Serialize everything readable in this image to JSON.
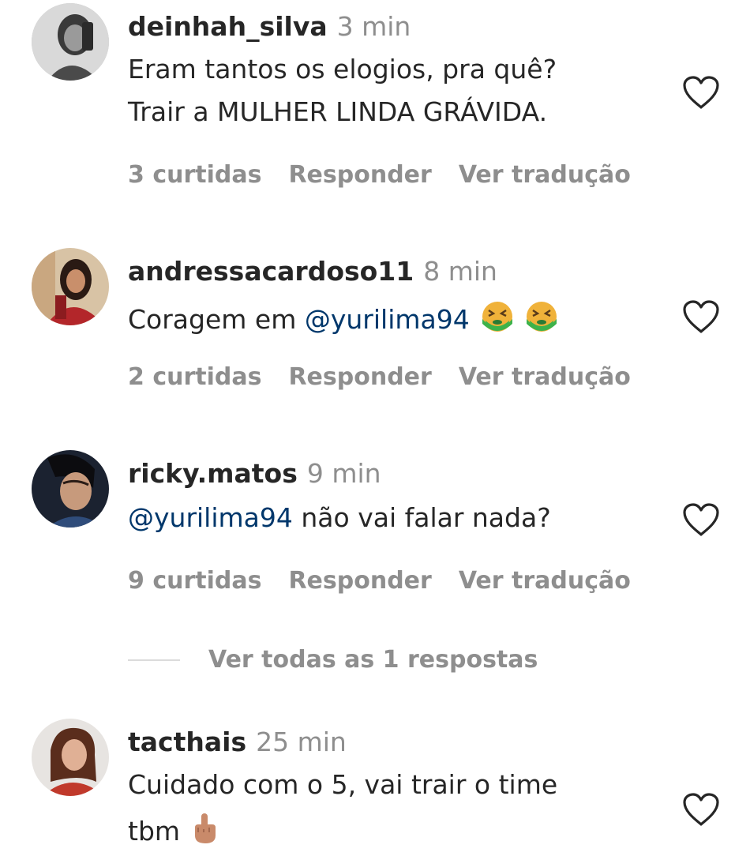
{
  "colors": {
    "text": "#262626",
    "secondary": "#8e8e8e",
    "mention": "#00376b",
    "divider": "#dbdbdb"
  },
  "comments": [
    {
      "username": "deinhah_silva",
      "time": "3 min",
      "lines": [
        "Eram tantos os elogios, pra quê?",
        "Trair a MULHER LINDA GRÁVIDA."
      ],
      "likes": "3 curtidas",
      "reply": "Responder",
      "translate": "Ver tradução",
      "heart_icon": "heart-outline-icon"
    },
    {
      "username": "andressacardoso11",
      "time": "8 min",
      "text_before": "Coragem em ",
      "mention": "@yurilima94",
      "emojis": [
        "nauseated-face-emoji",
        "nauseated-face-emoji"
      ],
      "likes": "2 curtidas",
      "reply": "Responder",
      "translate": "Ver tradução",
      "heart_icon": "heart-outline-icon"
    },
    {
      "username": "ricky.matos",
      "time": "9 min",
      "mention": "@yurilima94",
      "text_after": " não vai falar nada?",
      "likes": "9 curtidas",
      "reply": "Responder",
      "translate": "Ver tradução",
      "heart_icon": "heart-outline-icon"
    },
    {
      "username": "tacthais",
      "time": "25 min",
      "lines": [
        "Cuidado com o 5, vai trair o time",
        "tbm"
      ],
      "emojis": [
        "middle-finger-emoji"
      ],
      "heart_icon": "heart-outline-icon"
    }
  ],
  "view_replies": {
    "label": "Ver todas as 1 respostas"
  }
}
